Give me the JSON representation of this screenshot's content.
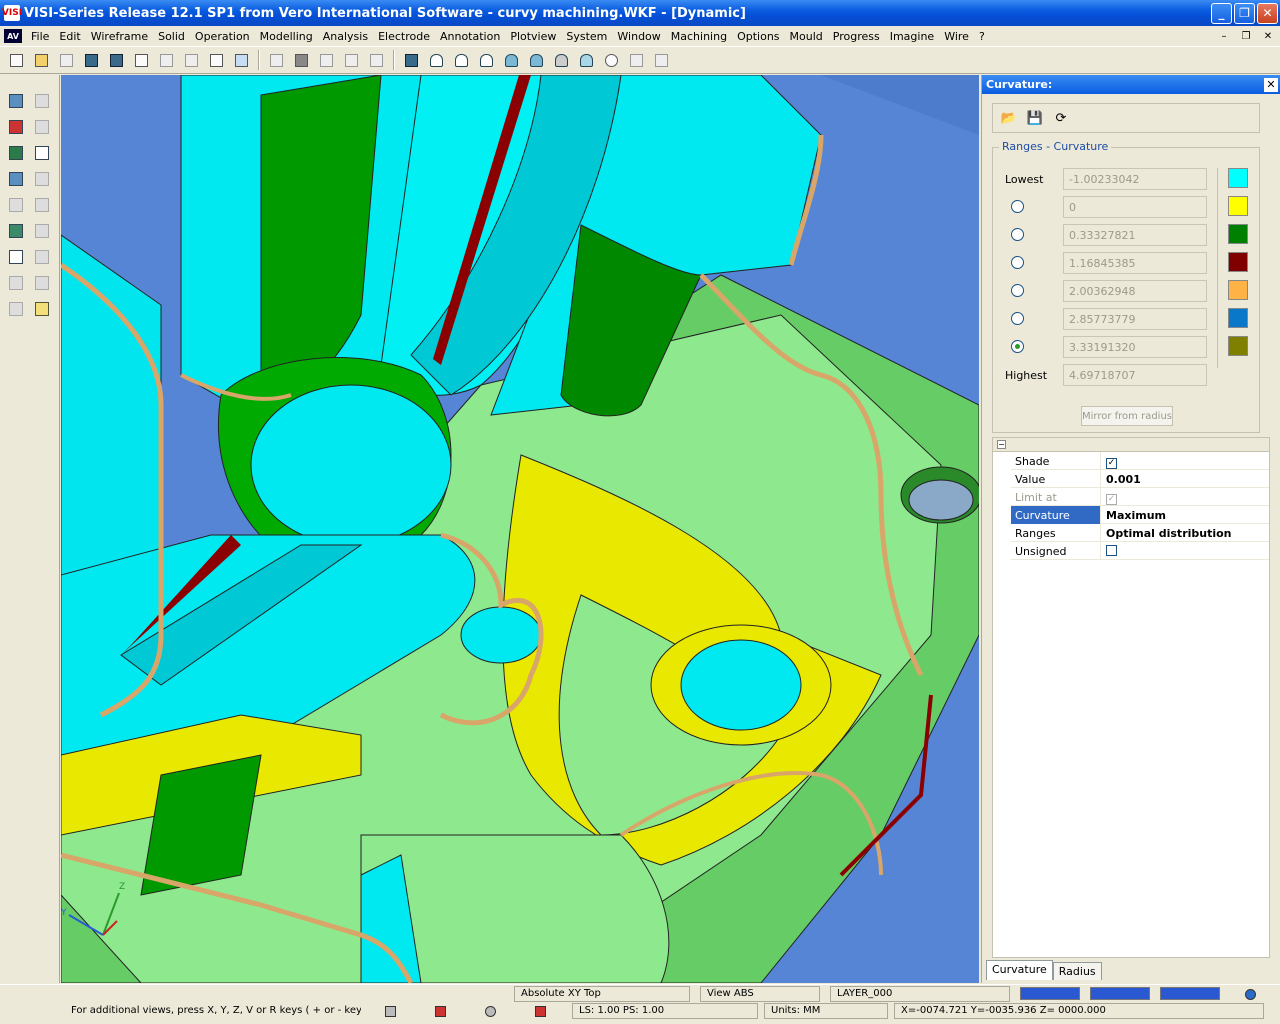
{
  "window": {
    "title": "VISI-Series Release 12.1 SP1 from Vero International Software - curvy machining.WKF - [Dynamic]",
    "app_icon": "VISI"
  },
  "menu": {
    "logo": "AV",
    "items": [
      "File",
      "Edit",
      "Wireframe",
      "Solid",
      "Operation",
      "Modelling",
      "Analysis",
      "Electrode",
      "Annotation",
      "Plotview",
      "System",
      "Window",
      "Machining",
      "Options",
      "Mould",
      "Progress",
      "Imagine",
      "Wire",
      "?"
    ]
  },
  "panel": {
    "title": "Curvature:",
    "ranges_title": "Ranges - Curvature",
    "lowest_label": "Lowest",
    "highest_label": "Highest",
    "ranges": [
      "-1.00233042",
      "0",
      "0.33327821",
      "1.16845385",
      "2.00362948",
      "2.85773779",
      "3.33191320",
      "4.69718707"
    ],
    "selected_index": 6,
    "colors": [
      "#00ffff",
      "#ffff00",
      "#008000",
      "#800000",
      "#ffb347",
      "#0a78c8",
      "#808000"
    ],
    "mirror_button": "Mirror from radius",
    "properties": [
      {
        "name": "Shade",
        "value": "",
        "checkbox": true,
        "checked": true
      },
      {
        "name": "Value",
        "value": "0.001"
      },
      {
        "name": "Limit at bottom",
        "value": "",
        "checkbox": true,
        "checked": true,
        "disabled": true
      },
      {
        "name": "Curvature",
        "value": "Maximum",
        "selected": true
      },
      {
        "name": "Ranges",
        "value": "Optimal distribution"
      },
      {
        "name": "Unsigned",
        "value": "",
        "checkbox": true,
        "checked": false
      }
    ],
    "tabs": [
      "Curvature",
      "Radius"
    ],
    "active_tab": "Curvature"
  },
  "status": {
    "hint": "For additional views, press X, Y, Z, V or R keys ( + or - keys",
    "view_mode": "Absolute XY Top",
    "view": "View ABS",
    "layer": "LAYER_000",
    "ls_ps": "LS: 1.00 PS: 1.00",
    "units": "Units: MM",
    "coords": "X=-0074.721 Y=-0035.936 Z= 0000.000"
  },
  "viewport": {
    "axis_label": "Z",
    "axis_label_y": "Y"
  }
}
